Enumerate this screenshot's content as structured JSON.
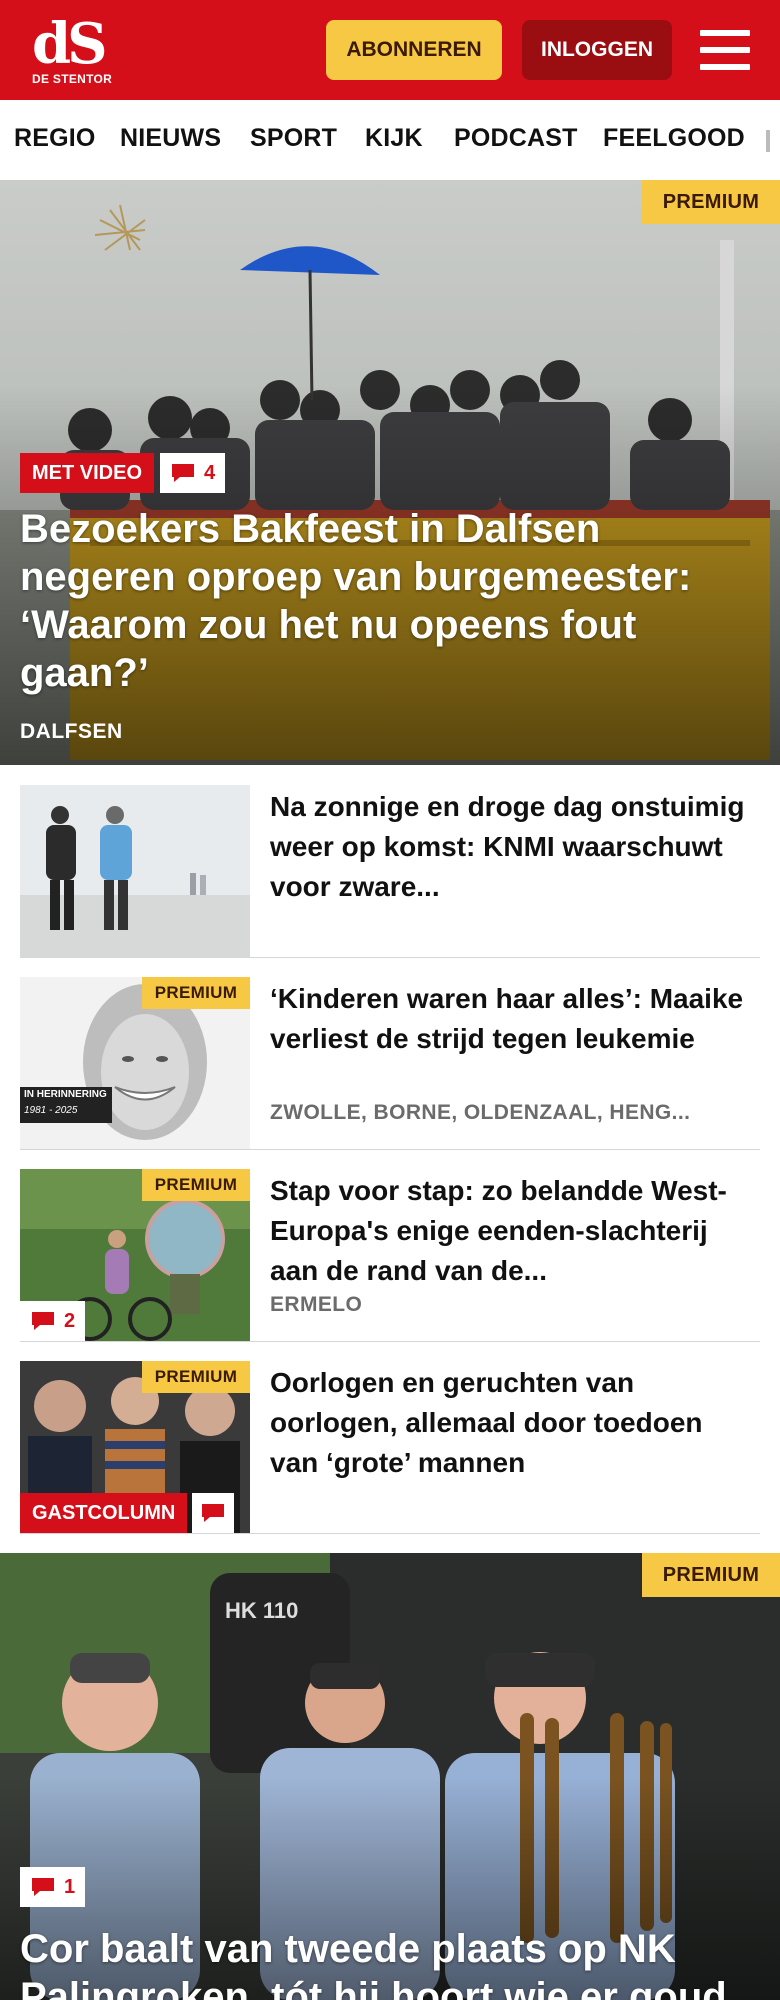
{
  "header": {
    "logo_main": "dS",
    "logo_sub": "DE STENTOR",
    "subscribe_label": "ABONNEREN",
    "login_label": "INLOGGEN",
    "colors": {
      "brand": "#d40f1a",
      "accent": "#f7c844",
      "login": "#9a0e12"
    }
  },
  "nav": {
    "items": [
      "REGIO",
      "NIEUWS",
      "SPORT",
      "KIJK",
      "PODCAST",
      "FEELGOOD"
    ]
  },
  "hero": {
    "premium_label": "PREMIUM",
    "video_label": "MET VIDEO",
    "comments": "4",
    "title": "Bezoekers Bakfeest in Dalfsen negeren oproep van burgemeester: ‘Waarom zou het nu opeens fout gaan?’",
    "region": "DALFSEN"
  },
  "articles": [
    {
      "title": "Na zonnige en droge dag onstuimig weer op komst: KNMI waarschuwt voor zware...",
      "region": "",
      "premium_label": "",
      "comments": "",
      "tag_label": ""
    },
    {
      "title": "‘Kinderen waren haar alles’: Maaike verliest de strijd tegen leukemie",
      "region": "ZWOLLE, BORNE, OLDENZAAL, HENG...",
      "premium_label": "PREMIUM",
      "comments": "",
      "tag_label": "",
      "thumb_caption": "IN HERINNERING",
      "thumb_years": "1981 - 2025"
    },
    {
      "title": "Stap voor stap: zo belandde West-Europa's enige eenden-slachterij aan de rand van de...",
      "region": "ERMELO",
      "premium_label": "PREMIUM",
      "comments": "2",
      "tag_label": ""
    },
    {
      "title": "Oorlogen en geruchten van oorlogen, allemaal door toedoen van ‘grote’ mannen",
      "region": "",
      "premium_label": "PREMIUM",
      "comments": "",
      "tag_label": "GASTCOLUMN"
    }
  ],
  "hero2": {
    "premium_label": "PREMIUM",
    "comments": "1",
    "sign_text": "HK 110",
    "title": "Cor baalt van tweede plaats op NK Palingroken, tót hij hoort wie er goud"
  }
}
